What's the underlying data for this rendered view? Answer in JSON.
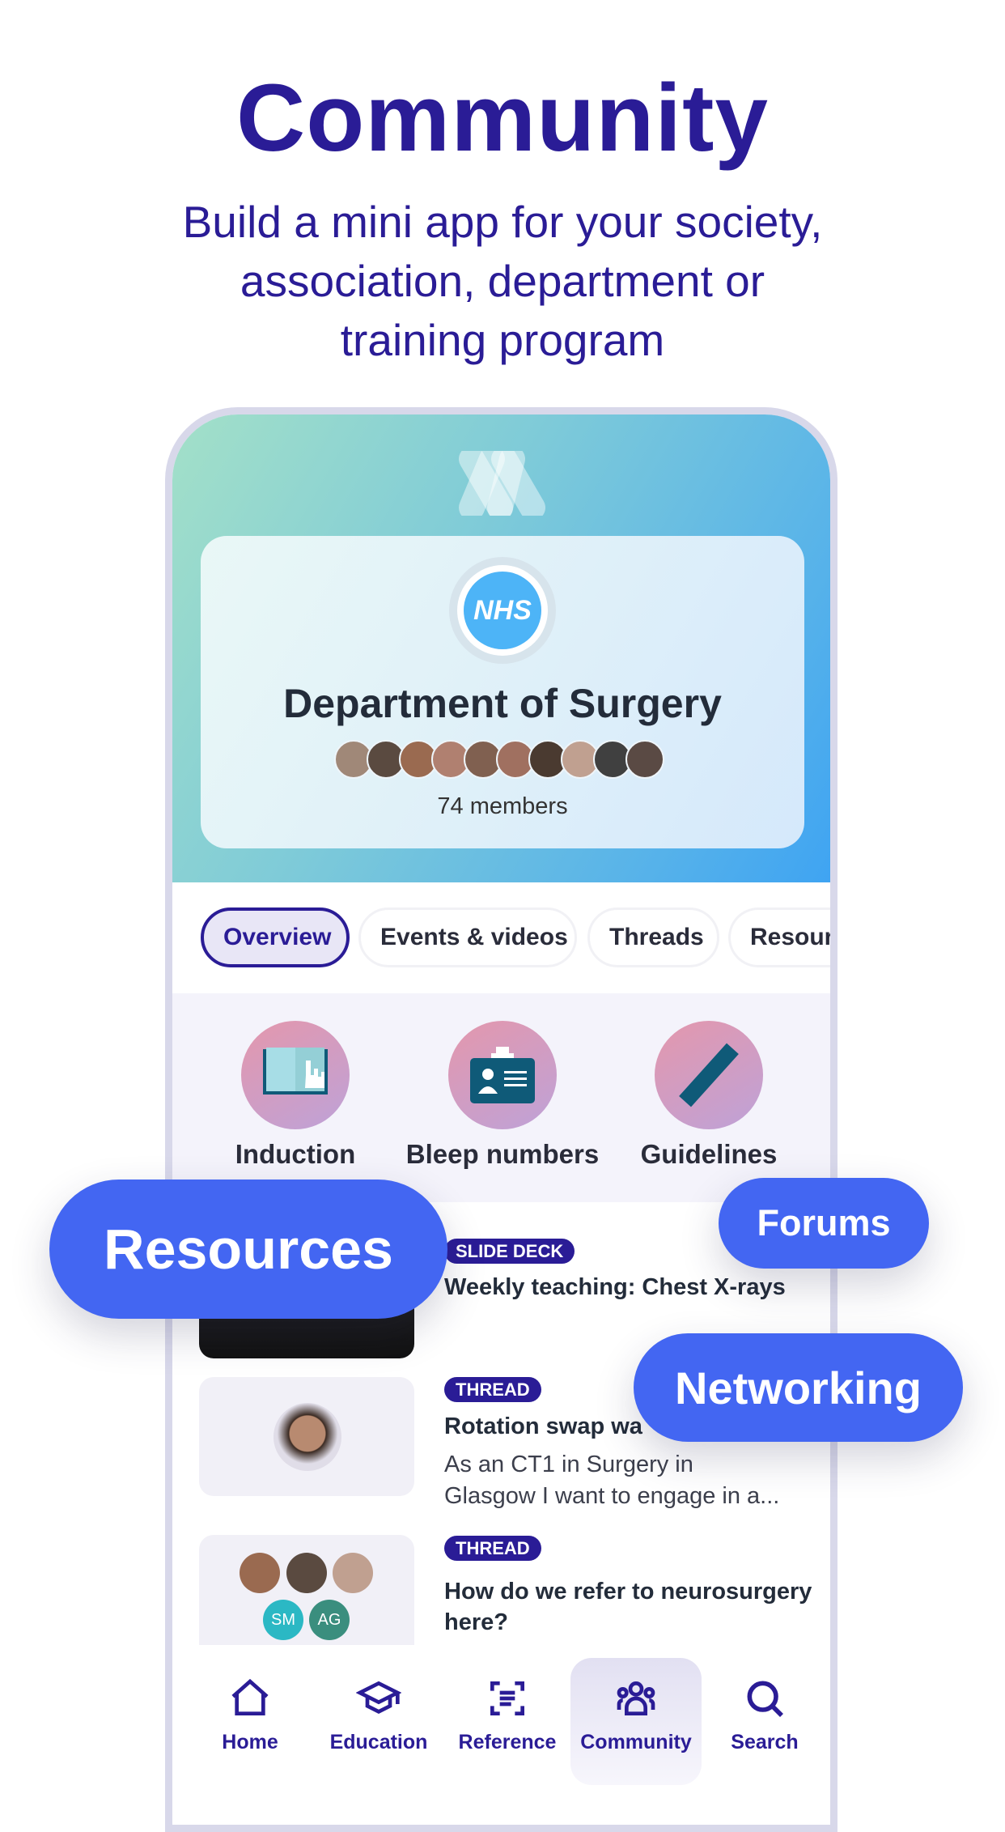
{
  "headline": "Community",
  "subheadline": [
    "Build a mini app for your society,",
    "association, department or",
    "training program"
  ],
  "group": {
    "badge": "NHS",
    "name": "Department of Surgery",
    "members": "74 members",
    "avatar_colors": [
      "#a08878",
      "#5a4a40",
      "#9a6a50",
      "#b08070",
      "#806050",
      "#a07060",
      "#4a3a30",
      "#c0a090",
      "#404040",
      "#5a4a44"
    ]
  },
  "tabs": [
    {
      "label": "Overview",
      "active": true
    },
    {
      "label": "Events & videos"
    },
    {
      "label": "Threads"
    },
    {
      "label": "Resour"
    }
  ],
  "quick_links": [
    {
      "label": "Induction",
      "icon": "book-icon"
    },
    {
      "label": "Bleep numbers",
      "icon": "id-card-icon"
    },
    {
      "label": "Guidelines",
      "icon": "ruler-icon"
    }
  ],
  "feed": [
    {
      "badge": "SLIDE DECK",
      "title": "Weekly teaching: Chest X-rays"
    },
    {
      "badge": "THREAD",
      "title": "Rotation swap wa",
      "desc": [
        "As an CT1 in Surgery in",
        "Glasgow I want to engage in a..."
      ]
    },
    {
      "badge": "THREAD",
      "title": "How do we refer to neurosurgery",
      "title2": "here?",
      "initials": [
        "SM",
        "AG"
      ]
    }
  ],
  "nav": [
    {
      "label": "Home"
    },
    {
      "label": "Education"
    },
    {
      "label": "Reference"
    },
    {
      "label": "Community",
      "active": true
    },
    {
      "label": "Search"
    }
  ],
  "pills": {
    "resources": "Resources",
    "forums": "Forums",
    "networking": "Networking"
  },
  "colors": {
    "brand": "#2a1c96",
    "pill": "#4366f2"
  }
}
